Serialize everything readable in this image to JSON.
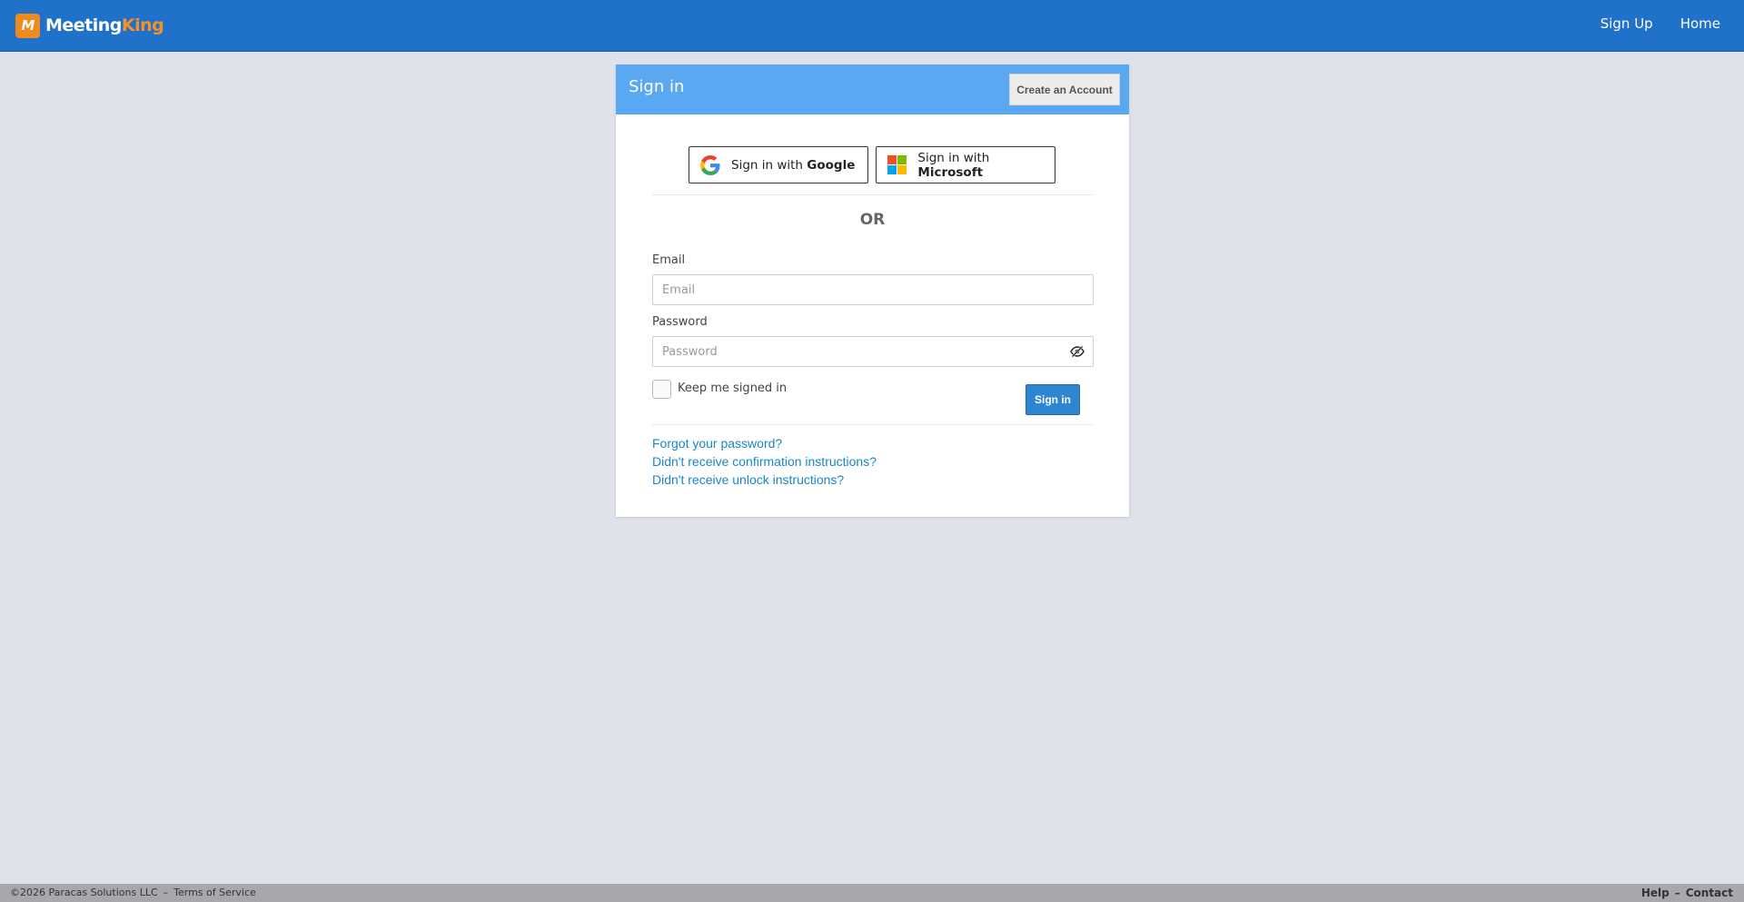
{
  "navbar": {
    "logo_mark": "M",
    "brand_part1": "Meeting",
    "brand_part2": "King",
    "links": [
      "Sign Up",
      "Home"
    ]
  },
  "card": {
    "title": "Sign in",
    "create_account_label": "Create an Account",
    "google": {
      "prefix": "Sign in with ",
      "brand": "Google"
    },
    "microsoft": {
      "prefix": "Sign in with ",
      "brand": "Microsoft"
    },
    "or_text": "OR",
    "email_label": "Email",
    "email_placeholder": "Email",
    "email_value": "",
    "password_label": "Password",
    "password_placeholder": "Password",
    "password_value": "",
    "keep_signed_in_label": "Keep me signed in",
    "keep_signed_in_checked": false,
    "signin_label": "Sign in",
    "links": [
      "Forgot your password?",
      "Didn't receive confirmation instructions?",
      "Didn't receive unlock instructions?"
    ]
  },
  "footer": {
    "copyright": "©2026 Paracas Solutions LLC",
    "separator": "–",
    "terms": "Terms of Service",
    "help": "Help",
    "contact": "Contact"
  },
  "colors": {
    "navbar": "#2071c9",
    "card_header": "#5aa8f2",
    "accent_orange": "#f08a1c",
    "link": "#1a86c7",
    "signin_button": "#2d86cf",
    "background": "#dfe2ea"
  },
  "icons": [
    "google-icon",
    "microsoft-icon",
    "eye-slash-icon"
  ]
}
